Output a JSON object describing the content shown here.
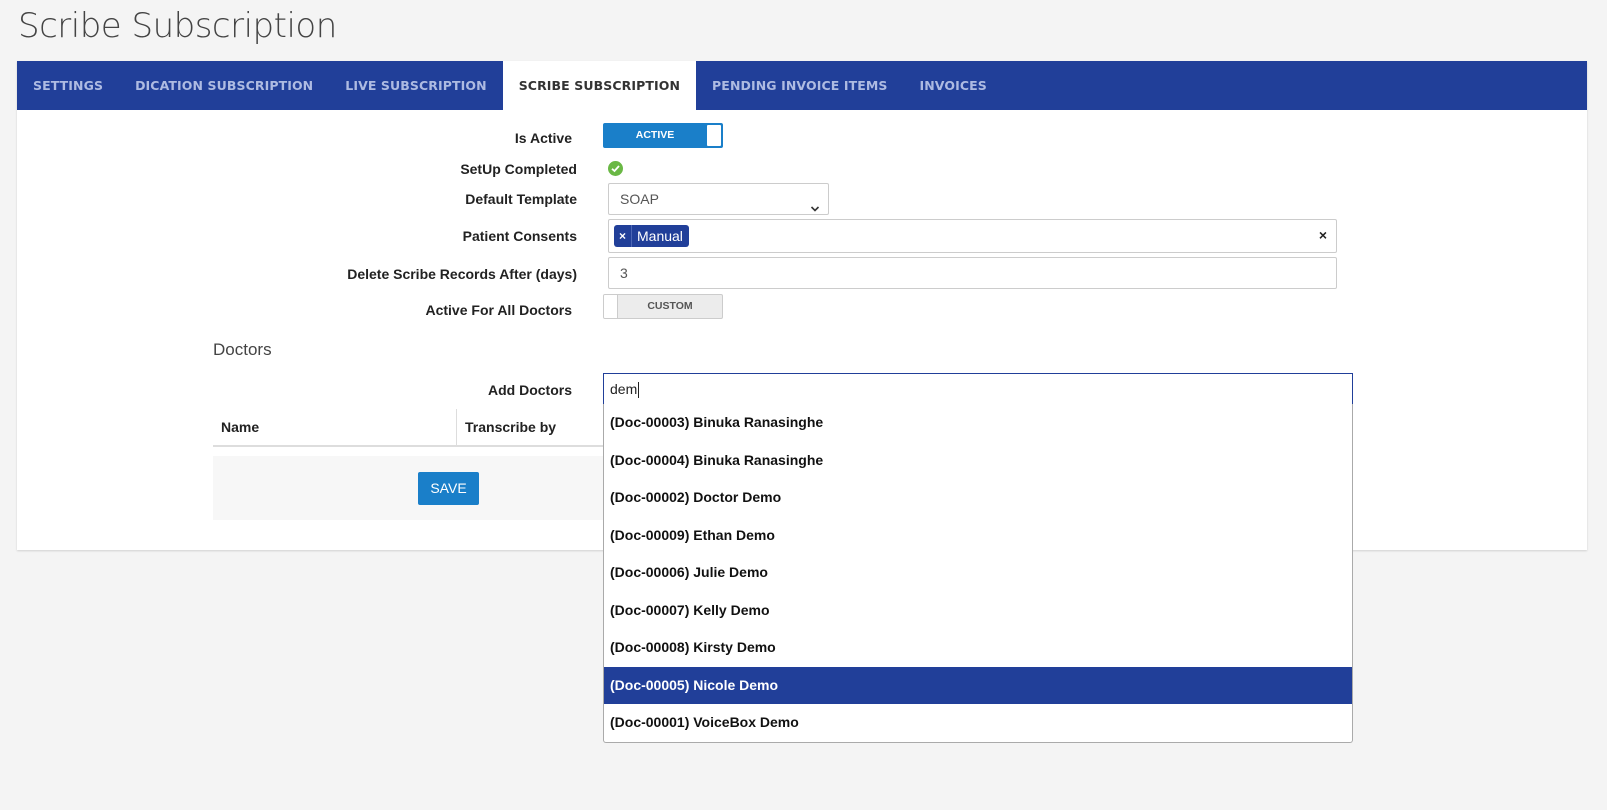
{
  "page": {
    "title": "Scribe Subscription"
  },
  "tabs": [
    {
      "label": "SETTINGS",
      "active": false
    },
    {
      "label": "DICATION SUBSCRIPTION",
      "active": false
    },
    {
      "label": "LIVE SUBSCRIPTION",
      "active": false
    },
    {
      "label": "SCRIBE SUBSCRIPTION",
      "active": true
    },
    {
      "label": "PENDING INVOICE ITEMS",
      "active": false
    },
    {
      "label": "INVOICES",
      "active": false
    }
  ],
  "form": {
    "is_active": {
      "label": "Is Active",
      "toggle_text": "ACTIVE",
      "on": true
    },
    "setup_completed": {
      "label": "SetUp Completed",
      "icon": "check-circle-icon",
      "done": true
    },
    "default_template": {
      "label": "Default Template",
      "value": "SOAP"
    },
    "patient_consents": {
      "label": "Patient Consents",
      "tags": [
        "Manual"
      ],
      "clear": "×",
      "remove": "×"
    },
    "delete_after": {
      "label": "Delete Scribe Records After (days)",
      "value": "3"
    },
    "active_for_all": {
      "label": "Active For All Doctors",
      "toggle_text": "CUSTOM",
      "on": false
    }
  },
  "doctors": {
    "section_title": "Doctors",
    "add_label": "Add Doctors",
    "search_value": "dem",
    "columns": [
      "Name",
      "Transcribe by"
    ],
    "suggestions": [
      "(Doc-00003) Binuka Ranasinghe",
      "(Doc-00004) Binuka Ranasinghe",
      "(Doc-00002) Doctor Demo",
      "(Doc-00009) Ethan Demo",
      "(Doc-00006) Julie Demo",
      "(Doc-00007) Kelly Demo",
      "(Doc-00008) Kirsty Demo",
      "(Doc-00005) Nicole Demo",
      "(Doc-00001) VoiceBox Demo"
    ],
    "highlighted_index": 7
  },
  "actions": {
    "save_label": "SAVE"
  },
  "colors": {
    "brand": "#213f99",
    "primary_button": "#1a7fc9",
    "success": "#6ab845"
  }
}
